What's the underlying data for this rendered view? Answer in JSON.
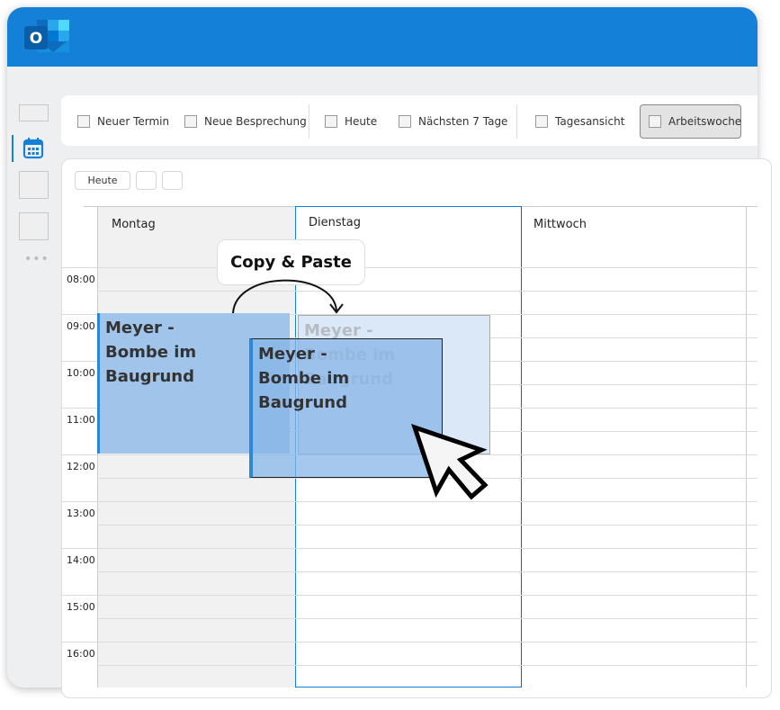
{
  "app": {
    "name": "Outlook",
    "accent": "#1580d8"
  },
  "toolbar": {
    "items": [
      {
        "label": "Neuer Termin"
      },
      {
        "label": "Neue Besprechung"
      },
      {
        "label": "Heute"
      },
      {
        "label": "Nächsten 7 Tage"
      },
      {
        "label": "Tagesansicht"
      },
      {
        "label": "Arbeitswoche",
        "selected": true
      }
    ]
  },
  "nav": {
    "today_label": "Heute"
  },
  "calendar": {
    "days": [
      "Montag",
      "Dienstag",
      "Mittwoch"
    ],
    "times": [
      "08:00",
      "09:00",
      "10:00",
      "11:00",
      "12:00",
      "13:00",
      "14:00",
      "15:00",
      "16:00"
    ],
    "event": {
      "title": "Meyer - Bombe im Baugrund",
      "line1": "Meyer -",
      "line2": "Bombe im",
      "line3": "Baugrund"
    }
  },
  "annotation": {
    "label": "Copy & Paste"
  }
}
